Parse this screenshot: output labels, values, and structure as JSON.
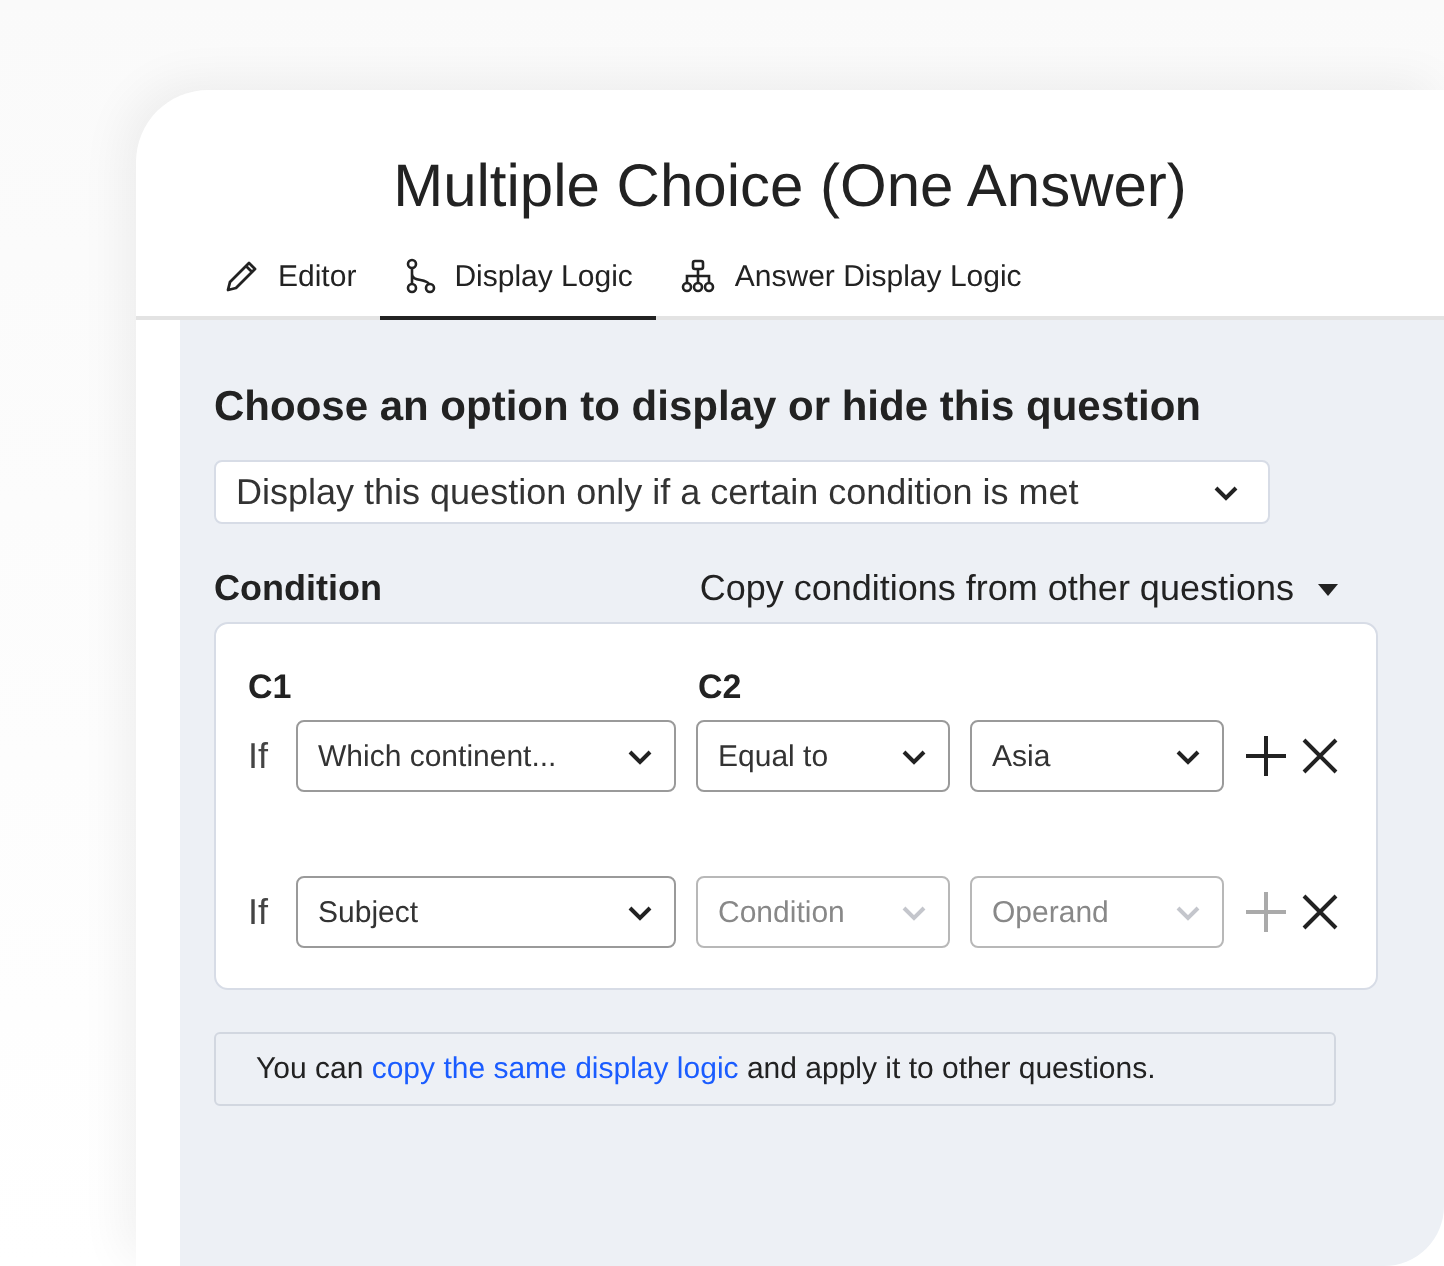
{
  "title": "Multiple Choice (One Answer)",
  "tabs": [
    {
      "label": "Editor",
      "kind": "pencil",
      "selected": false
    },
    {
      "label": "Display Logic",
      "kind": "branch",
      "selected": true
    },
    {
      "label": "Answer Display Logic",
      "kind": "tree",
      "selected": false
    }
  ],
  "heading": "Choose an option to display or hide this question",
  "mode_select": {
    "value": "Display this question only if a certain condition is met"
  },
  "condition_label": "Condition",
  "copy_conditions": "Copy conditions from other questions",
  "column_headers": [
    "C1",
    "C2"
  ],
  "rows": [
    {
      "prefix": "If",
      "selects": [
        {
          "value": "Which continent...",
          "disabled": false
        },
        {
          "value": "Equal to",
          "disabled": false
        },
        {
          "value": "Asia",
          "disabled": false
        }
      ],
      "add_disabled": false
    },
    {
      "prefix": "If",
      "selects": [
        {
          "value": "Subject",
          "disabled": false
        },
        {
          "value": "Condition",
          "disabled": true
        },
        {
          "value": "Operand",
          "disabled": true
        }
      ],
      "add_disabled": true
    }
  ],
  "note": {
    "before": "You can ",
    "link": "copy the same display logic",
    "after": " and apply it to other questions."
  }
}
